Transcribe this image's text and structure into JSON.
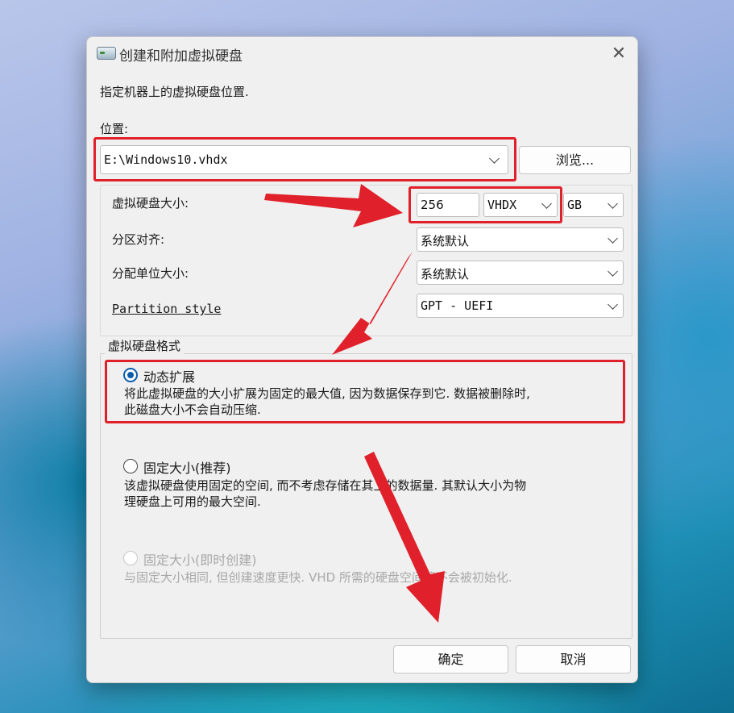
{
  "dialog": {
    "title": "创建和附加虚拟硬盘",
    "close_symbol": "✕",
    "instruction": "指定机器上的虚拟硬盘位置.",
    "location_label": "位置:",
    "location_value": "E:\\Windows10.vhdx",
    "browse_label": "浏览...",
    "size_label": "虚拟硬盘大小:",
    "size_value": "256",
    "format_value": "VHDX",
    "unit_value": "GB",
    "alignment_label": "分区对齐:",
    "alignment_value": "系统默认",
    "allocation_label": "分配单位大小:",
    "allocation_value": "系统默认",
    "partition_style_label": "Partition style",
    "partition_style_value": "GPT - UEFI",
    "format_group_title": "虚拟硬盘格式",
    "options": [
      {
        "label": "动态扩展",
        "desc_line1": "将此虚拟硬盘的大小扩展为固定的最大值, 因为数据保存到它. 数据被删除时,",
        "desc_line2": "此磁盘大小不会自动压缩.",
        "selected": true,
        "enabled": true
      },
      {
        "label": "固定大小(推荐)",
        "desc_line1": "该虚拟硬盘使用固定的空间, 而不考虑存储在其上的数据量. 其默认大小为物",
        "desc_line2": "理硬盘上可用的最大空间.",
        "selected": false,
        "enabled": true
      },
      {
        "label": "固定大小(即时创建)",
        "desc_line1": "与固定大小相同, 但创建速度更快. VHD 所需的硬盘空间将不会被初始化.",
        "desc_line2": "",
        "selected": false,
        "enabled": false
      }
    ],
    "ok_label": "确定",
    "cancel_label": "取消"
  },
  "colors": {
    "annotation_red": "#e0202a",
    "radio_accent": "#0a5dad",
    "dialog_bg": "#f0f0f0"
  },
  "icons": [
    "disk-icon",
    "close-icon",
    "chevron-down-icon"
  ]
}
